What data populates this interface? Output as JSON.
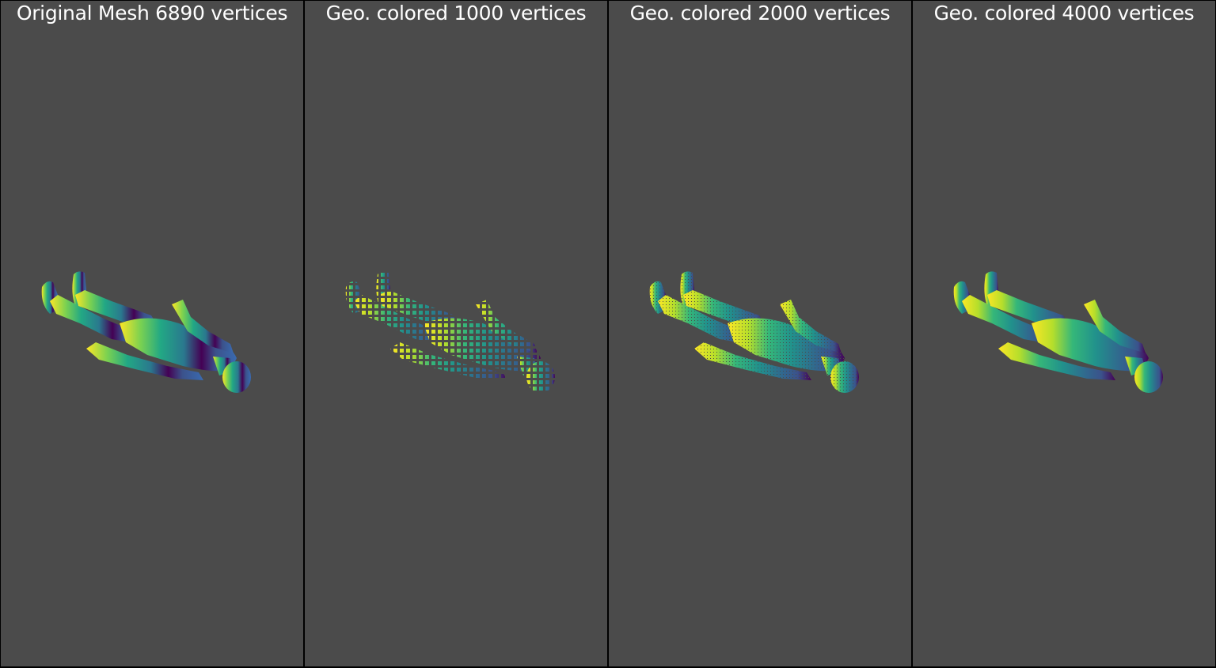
{
  "viewer": {
    "background_color": "#4b4b4b",
    "border_color": "#000000",
    "panels": [
      {
        "title": "Original Mesh 6890 vertices",
        "render_style": "mesh"
      },
      {
        "title": "Geo. colored 1000 vertices",
        "render_style": "points"
      },
      {
        "title": "Geo. colored 2000 vertices",
        "render_style": "points"
      },
      {
        "title": "Geo. colored 4000 vertices",
        "render_style": "points"
      }
    ],
    "colormap": "viridis"
  }
}
